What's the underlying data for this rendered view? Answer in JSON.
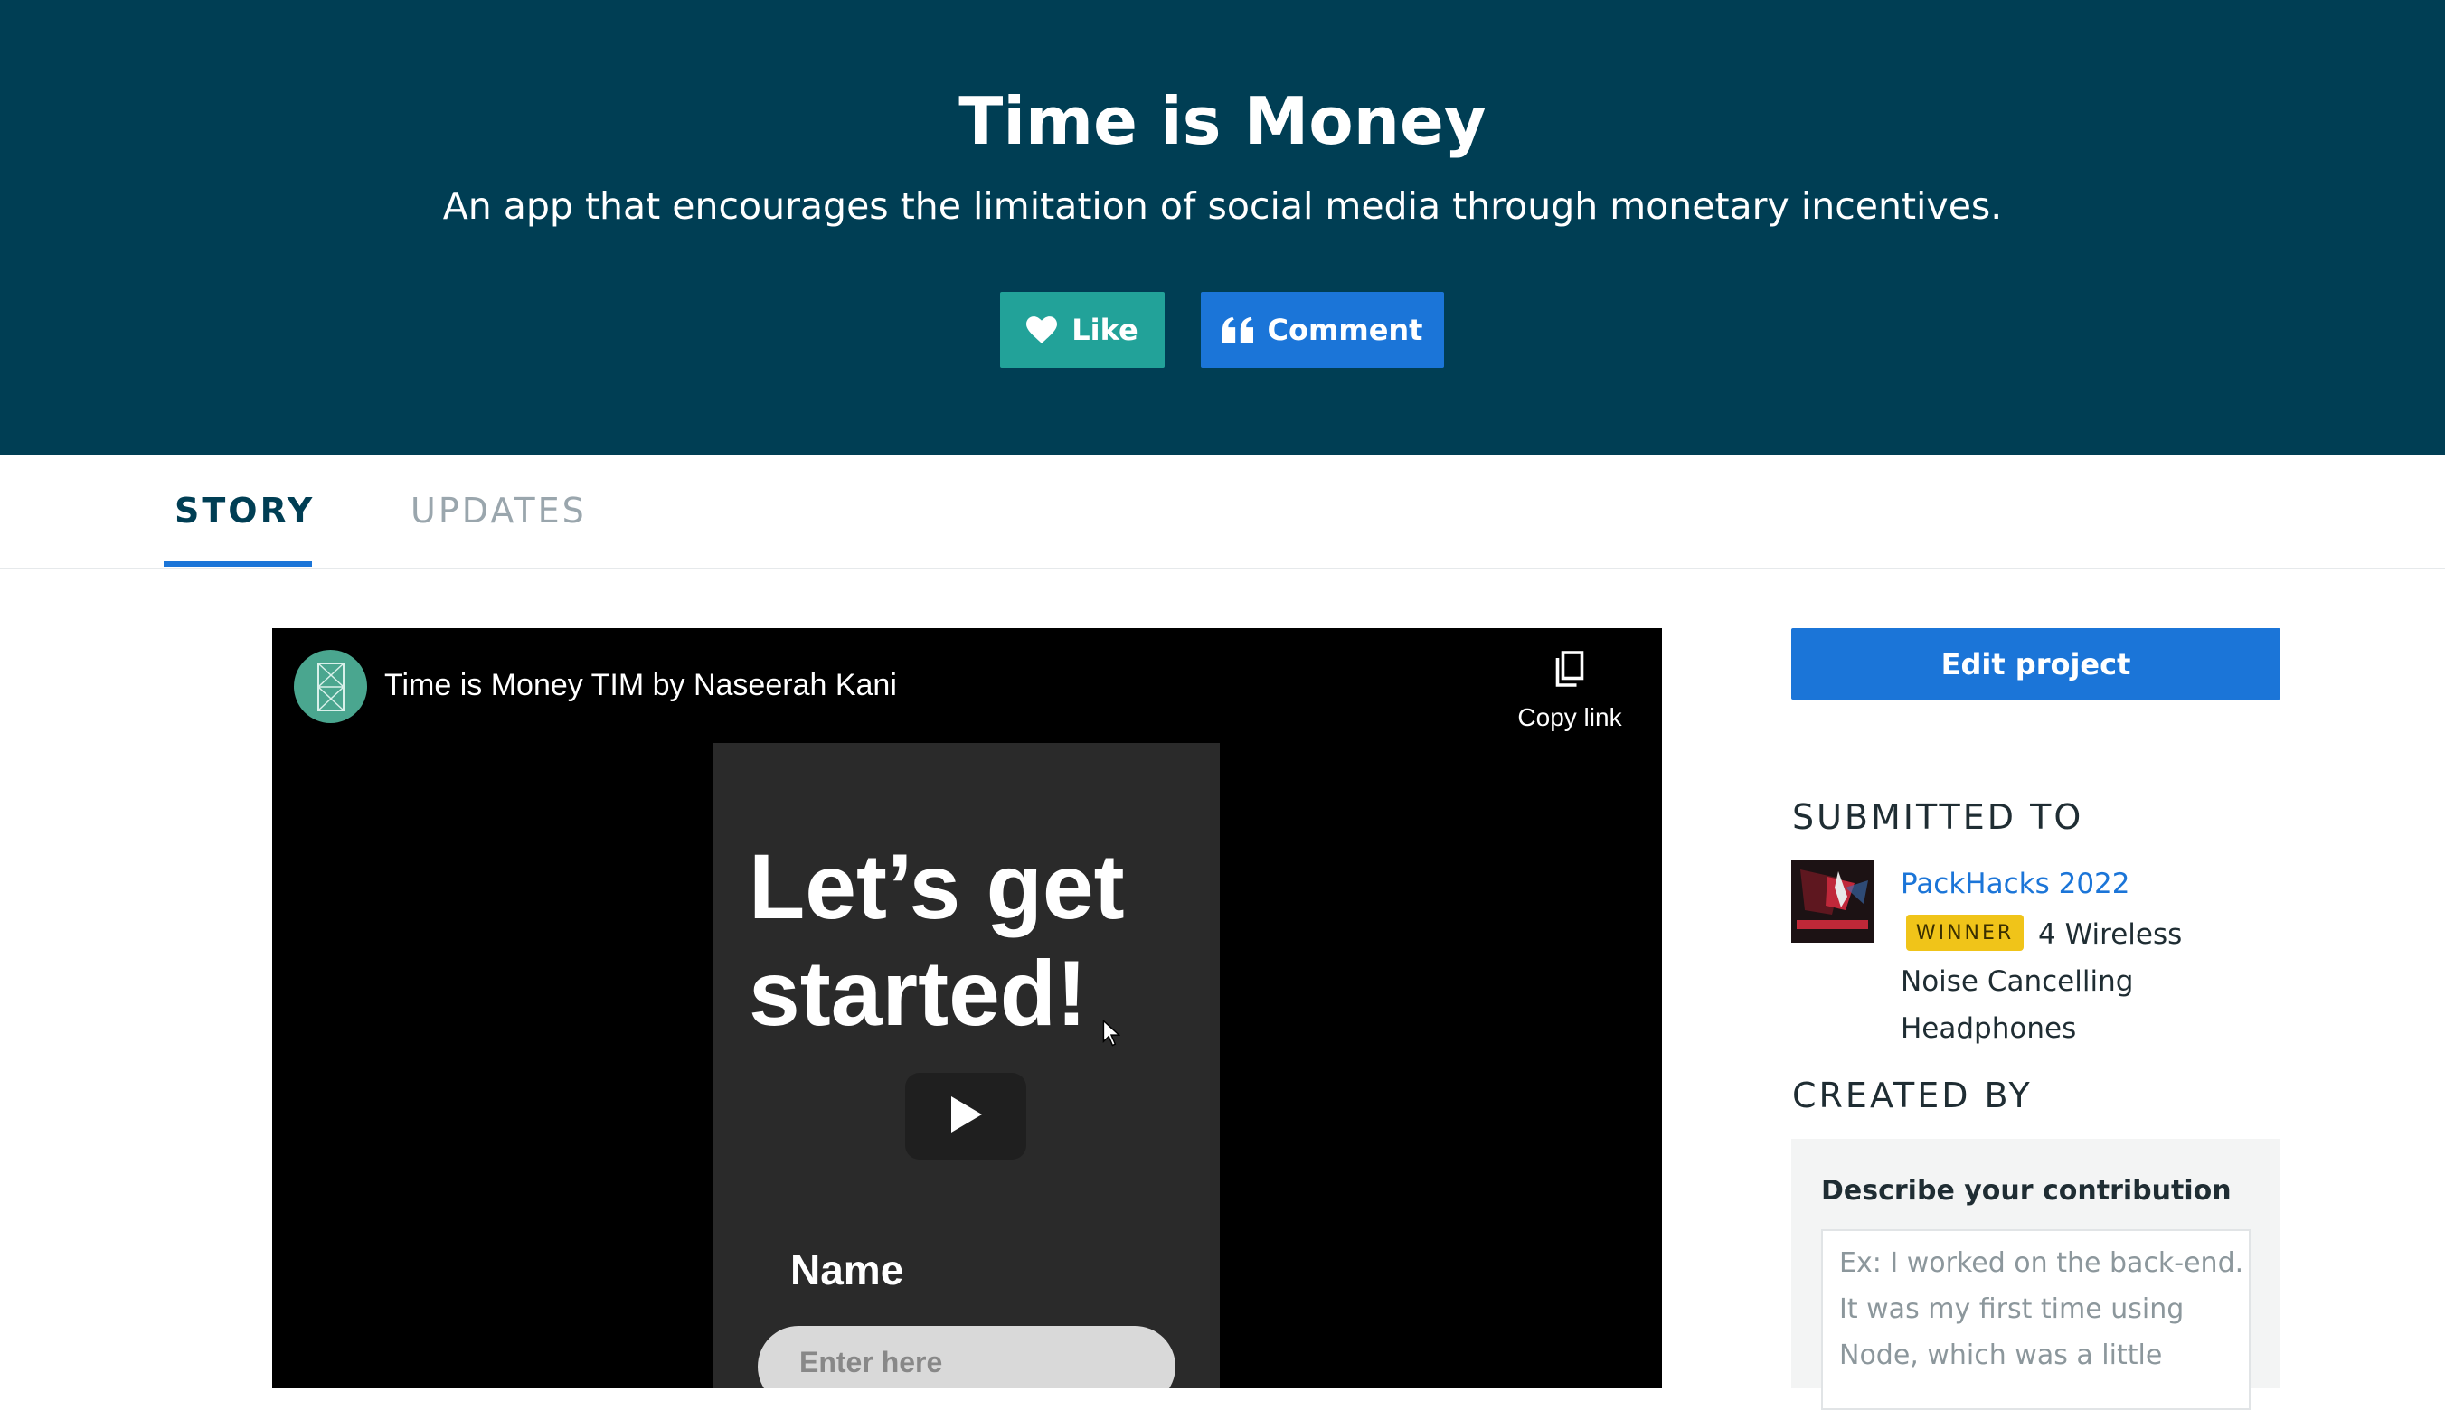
{
  "hero": {
    "title": "Time is Money",
    "subtitle": "An app that encourages the limitation of social media through monetary incentives.",
    "like_label": "Like",
    "comment_label": "Comment",
    "background_color": "#003e54",
    "like_color": "#22a299",
    "comment_color": "#1b75d8"
  },
  "tabs": [
    {
      "label": "STORY",
      "active": true
    },
    {
      "label": "UPDATES",
      "active": false
    }
  ],
  "video": {
    "title": "Time is Money TIM by Naseerah Kani",
    "copy_link_label": "Copy link",
    "preview_heading": "Let’s get\nstarted!",
    "preview_field_label": "Name",
    "preview_field_placeholder": "Enter here",
    "icons": [
      "channel-avatar-icon",
      "copy-icon",
      "play-icon"
    ]
  },
  "sidebar": {
    "edit_button_label": "Edit project",
    "submitted_to_heading": "SUBMITTED TO",
    "hackathon_name": "PackHacks 2022",
    "winner_badge": "WINNER",
    "prize": "4 Wireless Noise Cancelling Headphones",
    "created_by_heading": "CREATED BY",
    "contribution_label": "Describe your contribution",
    "contribution_placeholder": "Ex: I worked on the back-end. It was my first time using Node, which was a little",
    "winner_color": "#f0c419"
  }
}
